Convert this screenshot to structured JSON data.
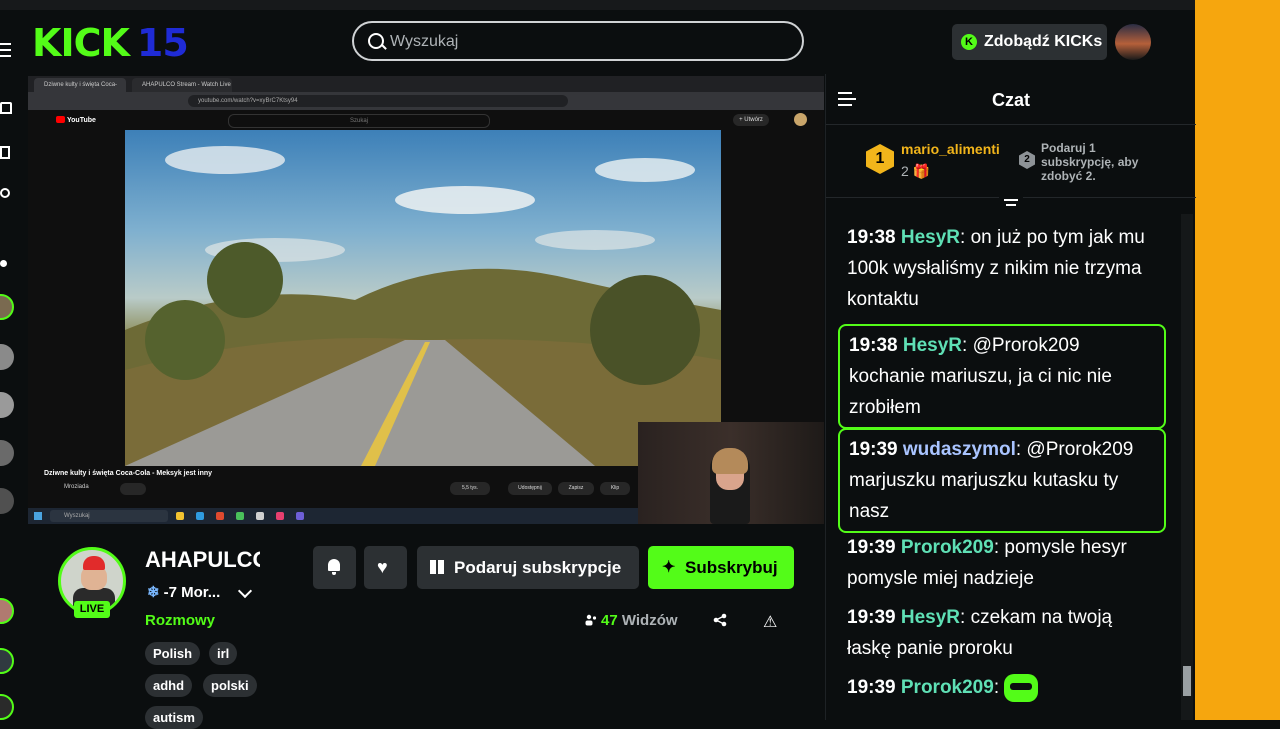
{
  "header": {
    "logo_text": "KICK",
    "logo_badge": "15",
    "search_placeholder": "Wyszukaj",
    "kicks_button": "Zdobądź KICKs"
  },
  "video": {
    "tabs": [
      "Dziwne kulty i święta Coca-Cola ...",
      "AHAPULCO Stream - Watch Live on ..."
    ],
    "url": "youtube.com/watch?v=xyBrC7Ktsy94",
    "yt_logo": "YouTube",
    "yt_search": "Szukaj",
    "yt_upload": "+ Utwórz",
    "yt_title": "Dziwne kulty i święta Coca-Cola - Meksyk jest inny",
    "yt_channel": "Mroziada",
    "yt_actions": [
      "5,5 tys.",
      "Udostępnij",
      "Zapisz",
      "Klip"
    ],
    "taskbar_search": "Wyszukaj"
  },
  "stream": {
    "name": "AHAPULCO",
    "subtitle": "-7 Mor...",
    "live_label": "LIVE",
    "category": "Rozmowy",
    "tags": [
      "Polish",
      "irl",
      "adhd",
      "polski",
      "autism"
    ],
    "gift_button": "Podaruj subskrypcje",
    "subscribe_button": "Subskrybuj",
    "viewers_count": "47",
    "viewers_label": "Widzów"
  },
  "chat": {
    "title": "Czat",
    "pinned": {
      "rank1": "1",
      "user": "mario_alimenti",
      "count": "2",
      "rank2": "2",
      "next_text": "Podaruj 1 subskrypcję, aby zdobyć 2."
    },
    "messages": [
      {
        "time": "19:38",
        "user": "HesyR",
        "color": "#5fe0b5",
        "text": "on już po tym jak mu 100k wysłaliśmy z nikim nie trzyma kontaktu",
        "highlight": false
      },
      {
        "time": "19:38",
        "user": "HesyR",
        "color": "#5fe0b5",
        "text": "@Prorok209 kochanie mariuszu, ja ci nic nie zrobiłem",
        "highlight": true
      },
      {
        "time": "19:39",
        "user": "wudaszymol",
        "color": "#a9c4ff",
        "text": "@Prorok209 marjuszku marjuszku kutasku ty nasz",
        "highlight": true
      },
      {
        "time": "19:39",
        "user": "Prorok209",
        "color": "#5fe0b5",
        "text": "pomysle hesyr pomysle miej nadzieje",
        "highlight": false
      },
      {
        "time": "19:39",
        "user": "HesyR",
        "color": "#5fe0b5",
        "text": "czekam na twoją łaskę panie proroku",
        "highlight": false
      },
      {
        "time": "19:39",
        "user": "Prorok209",
        "color": "#5fe0b5",
        "text": "",
        "highlight": false
      }
    ]
  },
  "colors": {
    "accent": "#53fc18",
    "background": "#0b0e0f",
    "panel": "#2c3033",
    "gold": "#f2b51b",
    "side_strip": "#f6a60e"
  }
}
